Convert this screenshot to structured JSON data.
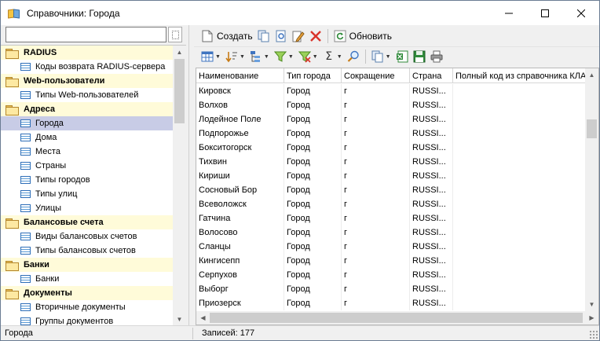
{
  "window": {
    "title": "Справочники: Города"
  },
  "left": {
    "search": {
      "value": "",
      "placeholder": ""
    },
    "tree": [
      {
        "type": "group",
        "label": "RADIUS"
      },
      {
        "type": "item",
        "label": "Коды возврата RADIUS-сервера"
      },
      {
        "type": "group",
        "label": "Web-пользователи"
      },
      {
        "type": "item",
        "label": "Типы Web-пользователей"
      },
      {
        "type": "group",
        "label": "Адреса"
      },
      {
        "type": "item",
        "label": "Города",
        "selected": true
      },
      {
        "type": "item",
        "label": "Дома"
      },
      {
        "type": "item",
        "label": "Места"
      },
      {
        "type": "item",
        "label": "Страны"
      },
      {
        "type": "item",
        "label": "Типы городов"
      },
      {
        "type": "item",
        "label": "Типы улиц"
      },
      {
        "type": "item",
        "label": "Улицы"
      },
      {
        "type": "group",
        "label": "Балансовые счета"
      },
      {
        "type": "item",
        "label": "Виды балансовых счетов"
      },
      {
        "type": "item",
        "label": "Типы балансовых счетов"
      },
      {
        "type": "group",
        "label": "Банки"
      },
      {
        "type": "item",
        "label": "Банки"
      },
      {
        "type": "group",
        "label": "Документы"
      },
      {
        "type": "item",
        "label": "Вторичные документы"
      },
      {
        "type": "item",
        "label": "Группы документов"
      }
    ]
  },
  "toolbar": {
    "create_label": "Создать",
    "refresh_label": "Обновить"
  },
  "grid": {
    "columns": [
      "Наименование",
      "Тип города",
      "Сокращение",
      "Страна",
      "Полный код из справочника КЛАДР"
    ],
    "rows": [
      [
        "Кировск",
        "Город",
        "г",
        "RUSSI...",
        ""
      ],
      [
        "Волхов",
        "Город",
        "г",
        "RUSSI...",
        ""
      ],
      [
        "Лодейное Поле",
        "Город",
        "г",
        "RUSSI...",
        ""
      ],
      [
        "Подпорожье",
        "Город",
        "г",
        "RUSSI...",
        ""
      ],
      [
        "Бокситогорск",
        "Город",
        "г",
        "RUSSI...",
        ""
      ],
      [
        "Тихвин",
        "Город",
        "г",
        "RUSSI...",
        ""
      ],
      [
        "Кириши",
        "Город",
        "г",
        "RUSSI...",
        ""
      ],
      [
        "Сосновый Бор",
        "Город",
        "г",
        "RUSSI...",
        ""
      ],
      [
        "Всеволожск",
        "Город",
        "г",
        "RUSSI...",
        ""
      ],
      [
        "Гатчина",
        "Город",
        "г",
        "RUSSI...",
        ""
      ],
      [
        "Волосово",
        "Город",
        "г",
        "RUSSI...",
        ""
      ],
      [
        "Сланцы",
        "Город",
        "г",
        "RUSSI...",
        ""
      ],
      [
        "Кингисепп",
        "Город",
        "г",
        "RUSSI...",
        ""
      ],
      [
        "Серпухов",
        "Город",
        "г",
        "RUSSI...",
        ""
      ],
      [
        "Выборг",
        "Город",
        "г",
        "RUSSI...",
        ""
      ],
      [
        "Приозерск",
        "Город",
        "г",
        "RUSSI...",
        ""
      ]
    ]
  },
  "status": {
    "left": "Города",
    "right": "Записей: 177"
  },
  "colors": {
    "group_bg": "#fffbd9",
    "selected_bg": "#c8cce6"
  }
}
